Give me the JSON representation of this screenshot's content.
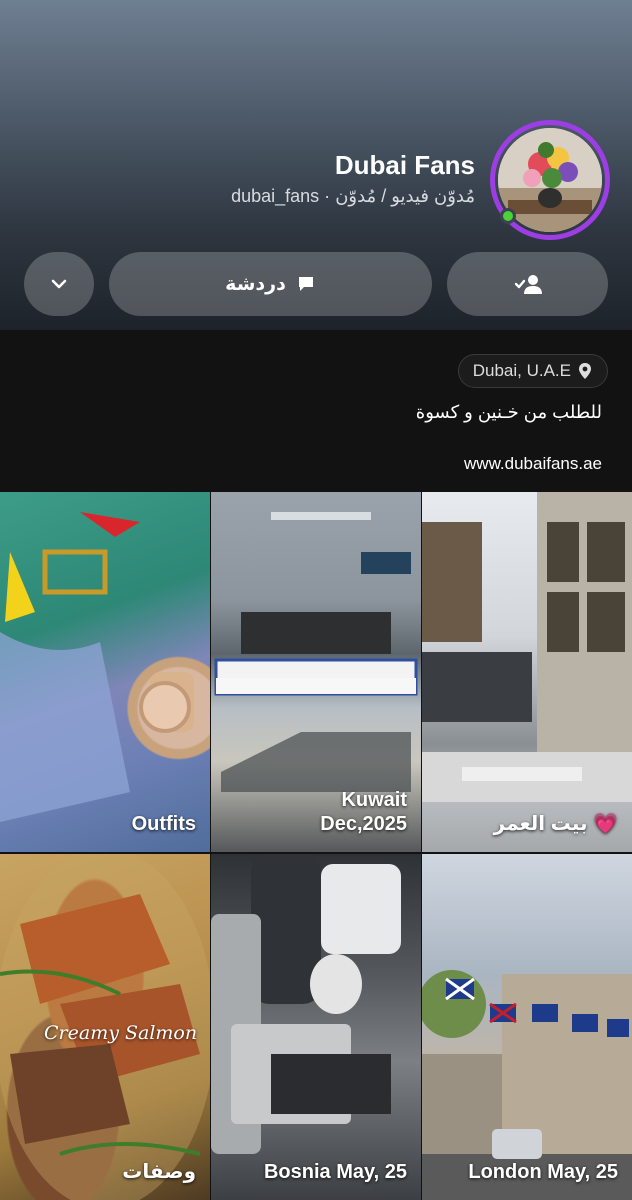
{
  "profile": {
    "name": "Dubai Fans",
    "subtitle": "dubai_fans · مُدوّن فيديو / مُدوّن",
    "online": true,
    "ring_color": "#9c3ee3"
  },
  "actions": {
    "more_icon": "chevron-down-icon",
    "chat_label": "دردشة",
    "chat_icon": "chat-bubble-icon",
    "friend_icon": "friend-added-icon"
  },
  "info": {
    "location": "Dubai, U.A.E",
    "location_icon": "location-pin-icon",
    "bio": "للطلب من خـنين و كسوة",
    "website": "www.dubaifans.ae"
  },
  "highlights": [
    {
      "caption": "Outfits"
    },
    {
      "caption_line1": "Kuwait",
      "caption_line2": "Dec,2025"
    },
    {
      "caption": "بيت العمر 💗"
    },
    {
      "caption": "وصفات",
      "overlay": "Creamy Salmon"
    },
    {
      "caption": "Bosnia May, 25"
    },
    {
      "caption": "London May, 25"
    }
  ]
}
